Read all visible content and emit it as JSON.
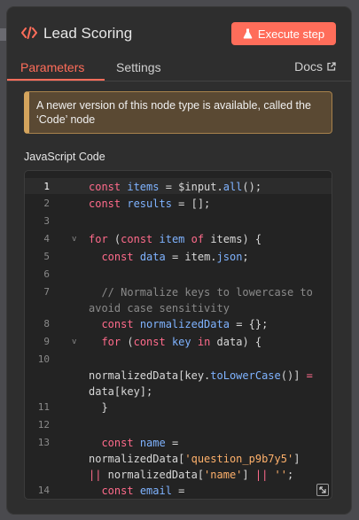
{
  "node": {
    "title": "Lead Scoring",
    "execute_label": "Execute step"
  },
  "tabs": {
    "parameters": "Parameters",
    "settings": "Settings",
    "docs": "Docs"
  },
  "notice": {
    "line1": "A newer version of this node type is available, called the",
    "line2": "‘Code’ node"
  },
  "code_label": "JavaScript Code",
  "line_numbers": [
    "1",
    "2",
    "3",
    "4",
    "5",
    "6",
    "7",
    "8",
    "9",
    "10",
    "11",
    "12",
    "13",
    "14"
  ],
  "code": {
    "l1": [
      [
        "kw",
        "const "
      ],
      [
        "var",
        "items"
      ],
      [
        "",
        "  = "
      ],
      [
        "",
        "$input."
      ],
      [
        "fn",
        "all"
      ],
      [
        "",
        "();"
      ]
    ],
    "l2": [
      [
        "kw",
        "const "
      ],
      [
        "var",
        "results"
      ],
      [
        "",
        ""
      ],
      [
        "kw",
        " = "
      ],
      [
        "",
        "[];"
      ]
    ]
  },
  "colors": {
    "accent": "#ff6d5a",
    "notice_border": "#d4a45d",
    "keyword": "#ff6b8b",
    "variable": "#7fb3ff",
    "string": "#ffb16b"
  },
  "icons": {
    "node_icon": "code-icon",
    "execute_icon": "flask-icon",
    "docs_icon": "external-link-icon"
  }
}
